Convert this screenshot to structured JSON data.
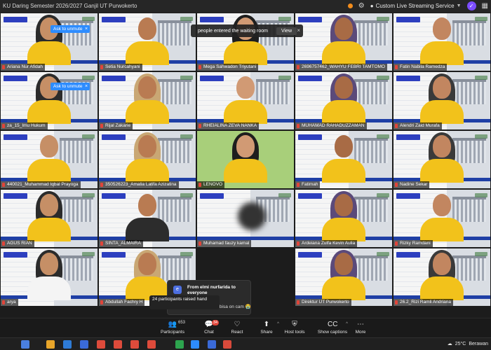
{
  "window": {
    "title": "KU Daring Semester 2026/2027 Ganjil UT Purwokerto",
    "live_stream_label": "Custom Live Streaming Service",
    "profile_initial": "✓"
  },
  "notifications": {
    "waiting_room_text": "people entered the waiting room",
    "waiting_room_view": "View",
    "unmute_label": "Ask to unmute",
    "chat_from": "From elmi nurfarida to everyone",
    "chat_message": "nggk bisa on cam",
    "chat_emoji": "😭",
    "raised_hands": "24 participants raised hand"
  },
  "tiles": [
    {
      "name": "Ariana Nur Afidah"
    },
    {
      "name": "Setia Nurcahyani"
    },
    {
      "name": "Mega Sahwadon Triyutani"
    },
    {
      "name": "2696757462_WAHYU FEBRI TAMTOMO"
    },
    {
      "name": "Fatin Nabila Ramedza"
    },
    {
      "name": "za_15_Imu Hukum"
    },
    {
      "name": "Rijal Zakarie"
    },
    {
      "name": "RHEIALINA ZEVA NANKA"
    },
    {
      "name": "MUHAMAD RAHADUZZAMAN"
    },
    {
      "name": "Alendri Zaid Murafa"
    },
    {
      "name": "440021_Muhammad Iqbal Prayoga"
    },
    {
      "name": "350526223_Amalia Latifa Azizatina"
    },
    {
      "name": "LENOVO"
    },
    {
      "name": "Fatimah"
    },
    {
      "name": "Nadine Sekar"
    },
    {
      "name": "AGUS RIAN"
    },
    {
      "name": "SINTA_ALMAIRA"
    },
    {
      "name": "Muhamad fauzy kamal"
    },
    {
      "name": "Ardeiana Zulfa Kevin Aulia"
    },
    {
      "name": "Rizky Ramdani"
    },
    {
      "name": "arya"
    },
    {
      "name": "Abdullah Fachry H"
    },
    {
      "name": ""
    },
    {
      "name": "Direktur UT Purwokerto"
    },
    {
      "name": "26.2_Rizi Ramli Andriana"
    }
  ],
  "toolbar": {
    "participants_label": "Participants",
    "participants_count": "653",
    "chat_label": "Chat",
    "chat_badge": "34",
    "react_label": "React",
    "share_label": "Share",
    "host_tools_label": "Host tools",
    "captions_label": "Show captions",
    "more_label": "More"
  },
  "taskbar": {
    "temperature": "25°C",
    "weather": "Berawan"
  },
  "colors": {
    "accent": "#2d8cff",
    "shirt_yellow": "#f2c21b",
    "name_band": "#1f3fa5",
    "badge_red": "#e0453a"
  }
}
